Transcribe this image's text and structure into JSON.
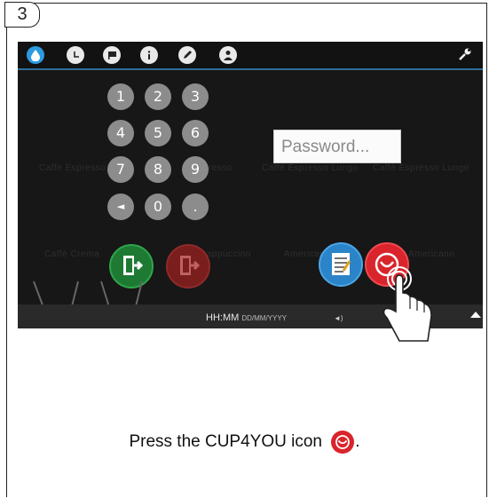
{
  "step": {
    "number": "3"
  },
  "toolbar": {
    "icons": [
      "water-drop-icon",
      "clock-icon",
      "flag-icon",
      "info-icon",
      "pencil-icon",
      "user-icon"
    ],
    "wrench_icon": "wrench-icon"
  },
  "keypad": {
    "keys": [
      "1",
      "2",
      "3",
      "4",
      "5",
      "6",
      "7",
      "8",
      "9",
      "◄",
      "0",
      "."
    ]
  },
  "password": {
    "placeholder": "Password..."
  },
  "background_products": {
    "row1": [
      "Caffè Espresso",
      "Espresso",
      "Caffè Espresso Lungo",
      "Caffè Espresso Lungo"
    ],
    "row2": [
      "Caffè Crema",
      "Cappuccino",
      "Americano",
      "Americano"
    ]
  },
  "buttons": {
    "exit_green": "exit-door-icon",
    "exit_red": "exit-door-icon",
    "task_list": "task-list-icon",
    "cup4you": "cup4you-icon"
  },
  "statusbar": {
    "time": "HH:MM",
    "date_format": "DD/MM/YYYY",
    "volume": "◄)"
  },
  "instruction": {
    "text": "Press the CUP4YOU icon",
    "suffix": "."
  },
  "colors": {
    "active_tab": "#2d9be0",
    "keypad": "#8c8c8c",
    "green_button": "#1e7a33",
    "red_button": "#d9242b",
    "blue_button": "#2b84c8"
  }
}
